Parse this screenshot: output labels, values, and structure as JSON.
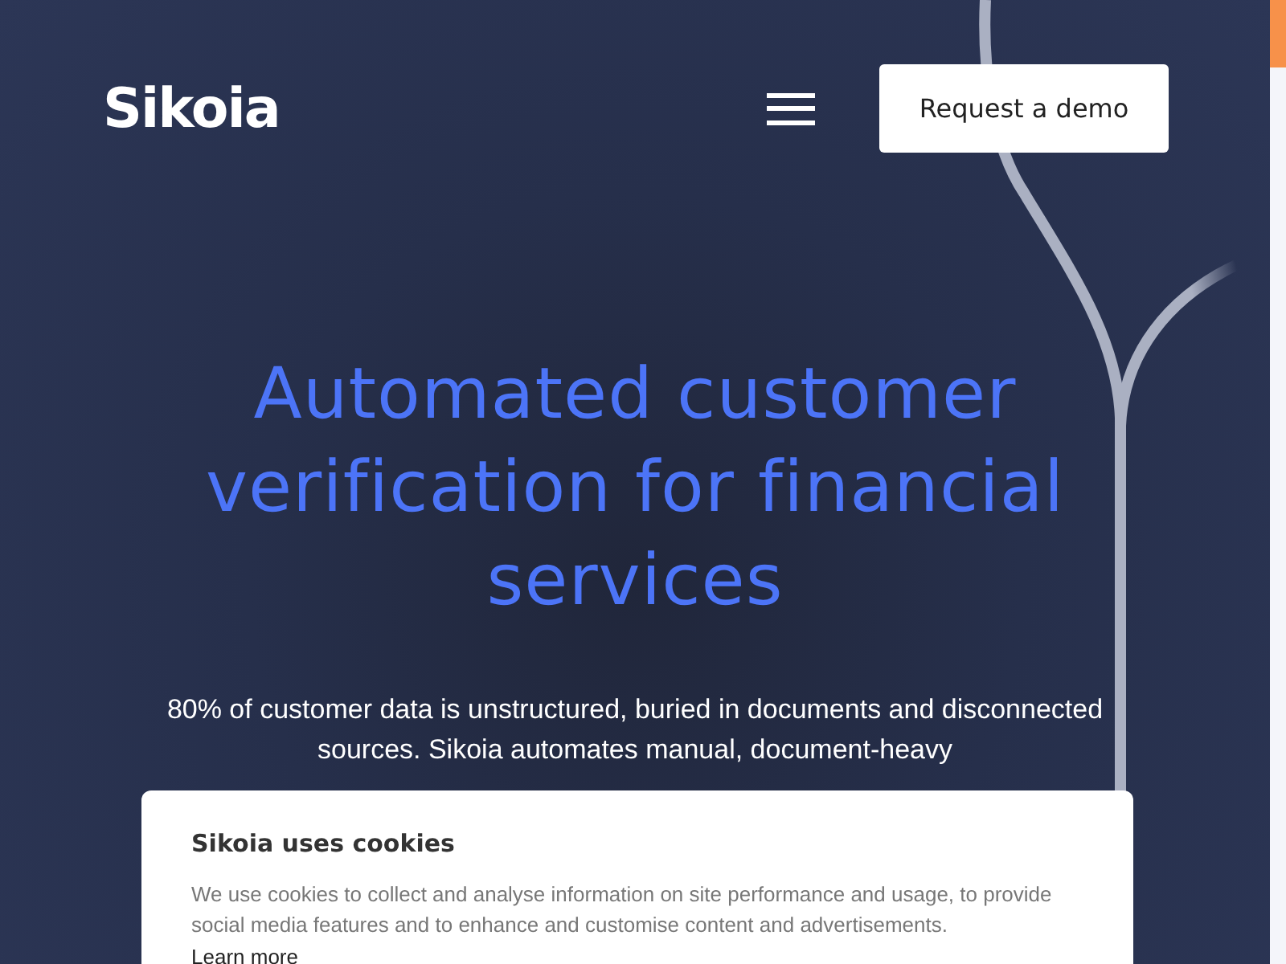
{
  "header": {
    "logo": "Sikoia",
    "cta": "Request a demo"
  },
  "hero": {
    "headline": "Automated customer verification for financial services",
    "intro": "80% of customer data is unstructured, buried in documents and disconnected sources. Sikoia automates manual, document-heavy"
  },
  "cookie_banner": {
    "title": "Sikoia uses cookies",
    "body": "We use cookies to collect and analyse information on site performance and usage, to provide social media features and to enhance and customise content and advertisements.",
    "link": "Learn more"
  }
}
